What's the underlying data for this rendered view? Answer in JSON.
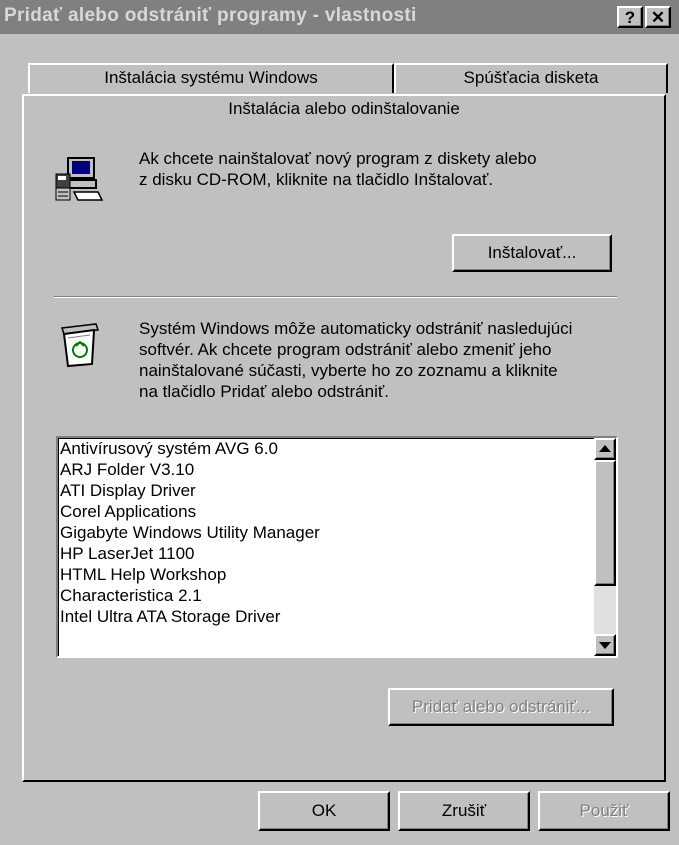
{
  "window": {
    "title": "Pridať alebo odstrániť programy - vlastnosti",
    "help_btn": "?",
    "close_btn": "✕"
  },
  "tabs": [
    {
      "label": "Inštalácia systému Windows"
    },
    {
      "label": "Spúšťacia disketa"
    },
    {
      "label": "Inštalácia alebo odinštalovanie",
      "active": true
    }
  ],
  "install_section": {
    "text_line1": "Ak chcete nainštalovať nový program z diskety alebo",
    "text_line2": "z disku CD-ROM, kliknite na tlačidlo Inštalovať.",
    "button": "Inštalovať..."
  },
  "remove_section": {
    "text_line1": "Systém Windows môže automaticky odstrániť nasledujúci",
    "text_line2": "softvér. Ak chcete program odstrániť alebo zmeniť jeho",
    "text_line3": "nainštalované súčasti, vyberte ho zo zoznamu a kliknite",
    "text_line4": "na tlačidlo Pridať alebo odstrániť.",
    "programs": [
      "Antivírusový systém AVG 6.0",
      "ARJ Folder V3.10",
      "ATI Display Driver",
      "Corel Applications",
      "Gigabyte Windows Utility Manager",
      "HP LaserJet 1100",
      "HTML Help Workshop",
      "Characteristica 2.1",
      "Intel Ultra ATA Storage Driver"
    ],
    "button": "Pridať alebo odstrániť..."
  },
  "footer": {
    "ok": "OK",
    "cancel": "Zrušiť",
    "apply": "Použiť"
  }
}
